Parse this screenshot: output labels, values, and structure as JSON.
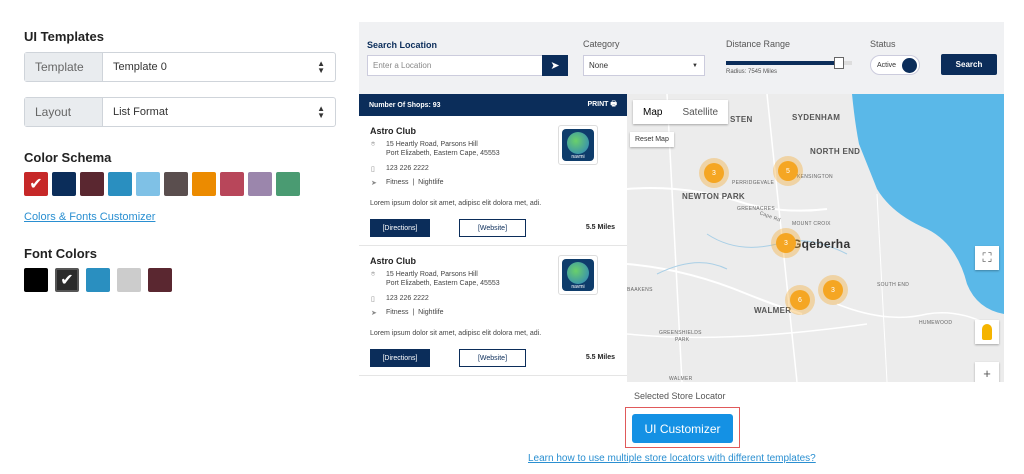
{
  "left": {
    "ui_templates_title": "UI Templates",
    "template_label": "Template",
    "template_value": "Template 0",
    "layout_label": "Layout",
    "layout_value": "List Format",
    "color_schema_title": "Color Schema",
    "color_swatches": [
      "#c62828",
      "#0b2d5a",
      "#5a2730",
      "#2a8fc0",
      "#7fc1e6",
      "#5a4e4e",
      "#ec8b00",
      "#b8465a",
      "#9b86ac",
      "#4a9b72"
    ],
    "colors_fonts_link": "Colors & Fonts Customizer",
    "font_colors_title": "Font Colors",
    "font_swatches": [
      "#000000",
      "#2b2b2b",
      "#2a8fc0",
      "#cccccc",
      "#5a2730"
    ]
  },
  "search": {
    "location_label": "Search Location",
    "location_placeholder": "Enter a Location",
    "category_label": "Category",
    "category_value": "None",
    "distance_label": "Distance Range",
    "radius_text": "Radius: 7545 Miles",
    "distance_fill": 0.9,
    "status_label": "Status",
    "status_value": "Active",
    "search_button": "Search"
  },
  "list": {
    "count_text": "Number Of Shops: 93",
    "print_text": "PRINT",
    "items": [
      {
        "name": "Astro Club",
        "address1": "15 Heartly Road, Parsons Hill",
        "address2": "Port Elizabeth, Eastern Cape, 45553",
        "phone": "123 226 2222",
        "cat1": "Fitness",
        "cat2": "Nightlife",
        "desc": "Lorem ipsum dolor sit amet, adipisc elit dolora met, adi.",
        "logo_text": "navmi",
        "directions": "[Directions]",
        "website": "[Website]",
        "miles": "5.5 Miles"
      },
      {
        "name": "Astro Club",
        "address1": "15 Heartly Road, Parsons Hill",
        "address2": "Port Elizabeth, Eastern Cape, 45553",
        "phone": "123 226 2222",
        "cat1": "Fitness",
        "cat2": "Nightlife",
        "desc": "Lorem ipsum dolor sit amet, adipisc elit dolora met, adi.",
        "logo_text": "navmi",
        "directions": "[Directions]",
        "website": "[Website]",
        "miles": "5.5 Miles"
      }
    ]
  },
  "map": {
    "tab_map": "Map",
    "tab_satellite": "Satellite",
    "reset": "Reset Map",
    "labels": {
      "sydenham": "SYDENHAM",
      "sten": "STEN",
      "north_end": "NORTH END",
      "perridgevale": "PERRIDGEVALE",
      "kensington": "KENSINGTON",
      "newton_park": "NEWTON PARK",
      "greenacres": "GREENACRES",
      "mount_croix": "MOUNT CROIX",
      "cape_rd": "Cape Rd",
      "gqeberha": "Gqeberha",
      "south_end": "SOUTH END",
      "walmer": "WALMER",
      "humewood": "HUMEWOOD",
      "greenshields": "GREENSHIELDS",
      "park": "PARK",
      "walmer2": "WALMER",
      "baakens": "BAAKENS"
    },
    "clusters": [
      "3",
      "5",
      "3",
      "6",
      "3"
    ]
  },
  "footer": {
    "selected_caption": "Selected Store Locator",
    "customizer_button": "UI Customizer",
    "learn_link": "Learn how to use multiple store locators with different templates?"
  }
}
